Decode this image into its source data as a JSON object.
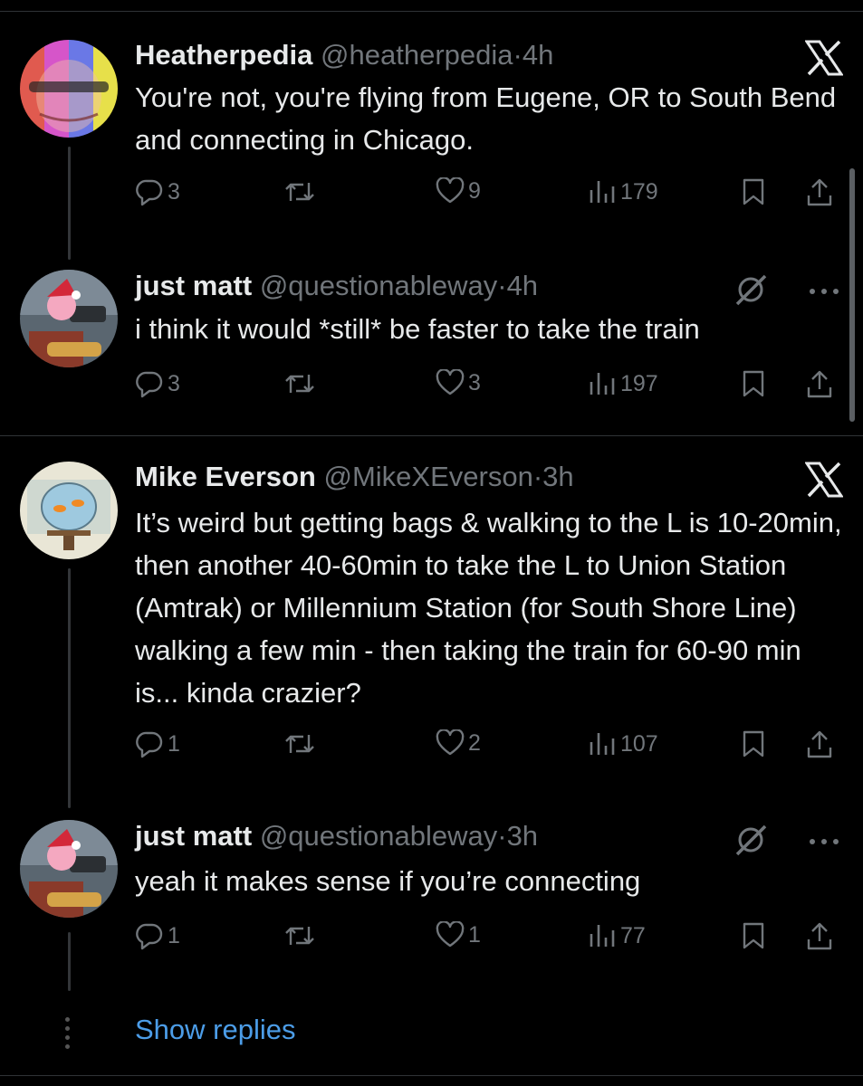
{
  "tweets": [
    {
      "name": "Heatherpedia",
      "handle": "@heatherpedia",
      "separator": "·",
      "time": "4h",
      "text": "You're not, you're flying from Eugene, OR to South Bend and connecting in Chicago.",
      "replies": "3",
      "retweets": "",
      "likes": "9",
      "views": "179",
      "corner_icon": "x-logo-icon"
    },
    {
      "name": "just matt",
      "handle": "@questionableway",
      "separator": "·",
      "time": "4h",
      "text": "i think it would *still* be faster to take the train",
      "replies": "3",
      "retweets": "",
      "likes": "3",
      "views": "197",
      "corner_icon": "grok-icon"
    },
    {
      "name": "Mike Everson",
      "handle": "@MikeXEverson",
      "separator": "·",
      "time": "3h",
      "text": "It’s weird but getting bags & walking to the L is 10-20min, then another 40-60min to take the L to Union Station (Amtrak) or Millennium Station (for South Shore Line) walking a few min - then taking the train for 60-90 min is... kinda crazier?",
      "replies": "1",
      "retweets": "",
      "likes": "2",
      "views": "107",
      "corner_icon": "x-logo-icon"
    },
    {
      "name": "just matt",
      "handle": "@questionableway",
      "separator": "·",
      "time": "3h",
      "text": "yeah it makes sense if you’re connecting",
      "replies": "1",
      "retweets": "",
      "likes": "1",
      "views": "77",
      "corner_icon": "grok-icon"
    }
  ],
  "show_replies": "Show replies",
  "colors": {
    "background": "#000000",
    "text": "#e7e9ea",
    "muted": "#71767b",
    "link": "#4c9de8"
  }
}
